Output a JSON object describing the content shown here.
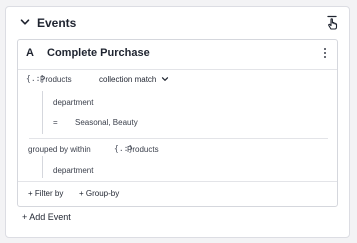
{
  "header": {
    "title": "Events",
    "collapse_icon": "chevron-down-icon",
    "action_icon": "pointer-hand-icon"
  },
  "event": {
    "letter": "A",
    "name": "Complete Purchase",
    "menu_icon": "kebab-menu-icon",
    "property_group": {
      "icon_text": "{.:}",
      "label": "Products",
      "operator": "collection match",
      "operator_icon": "chevron-down-icon"
    },
    "filter": {
      "property": "department",
      "comparator": "=",
      "values": "Seasonal, Beauty"
    },
    "grouped_by": {
      "label": "grouped by within",
      "icon_text": "{.:}",
      "collection": "Products",
      "property": "department"
    },
    "footer": {
      "filter_by": "+ Filter by",
      "group_by": "+ Group-by"
    }
  },
  "add_event": "+ Add Event"
}
